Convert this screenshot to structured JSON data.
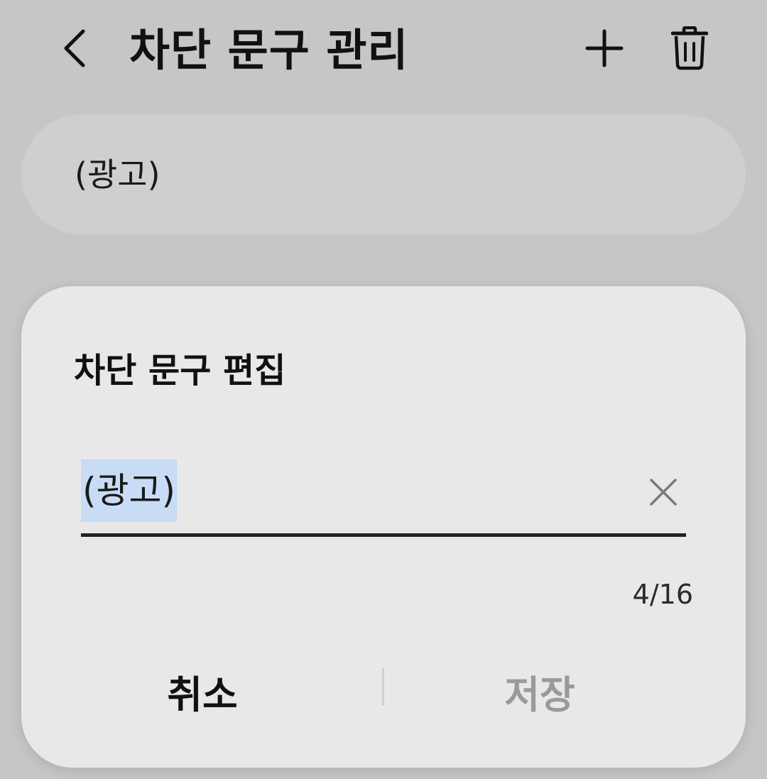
{
  "appbar": {
    "back_icon": "chevron-left-icon",
    "title": "차단 문구 관리",
    "add_icon": "plus-icon",
    "delete_icon": "trash-icon"
  },
  "list": {
    "items": [
      {
        "label": "(광고)"
      }
    ]
  },
  "dialog": {
    "title": "차단 문구 편집",
    "input": {
      "value": "(광고)",
      "selected": true,
      "clear_icon": "close-icon"
    },
    "char_count": "4/16",
    "cancel_label": "취소",
    "save_label": "저장",
    "save_enabled": false
  },
  "colors": {
    "background": "#c6c6c6",
    "list_item_bg": "#cfcfd0",
    "dialog_bg": "#e8e8e8",
    "selection": "#c8dcf5",
    "disabled_text": "#9a9a9a"
  }
}
